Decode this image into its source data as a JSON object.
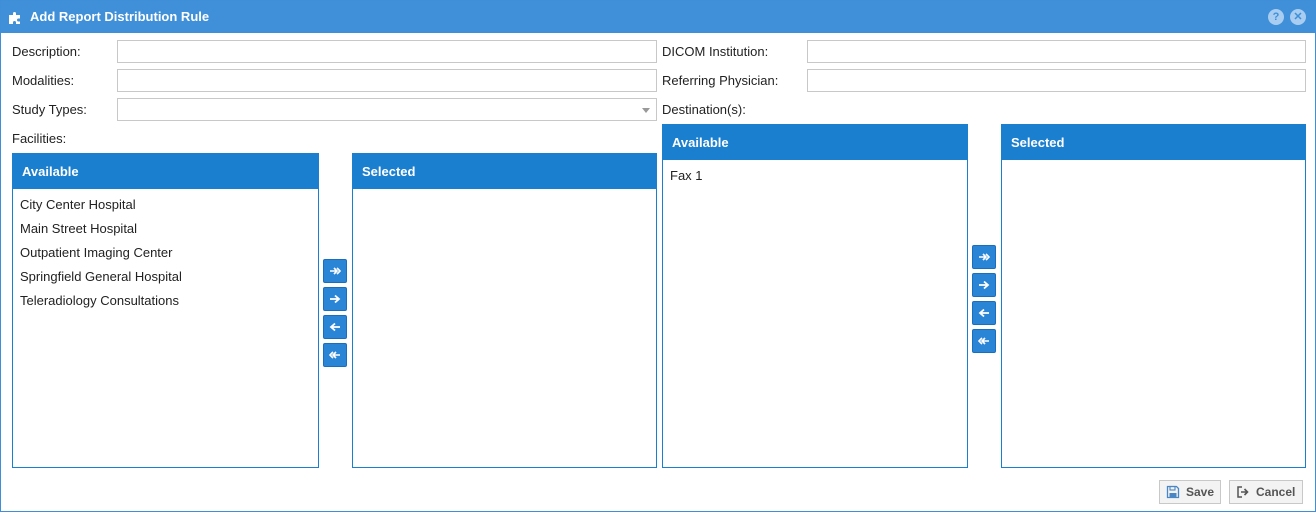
{
  "dialog": {
    "title": "Add Report Distribution Rule",
    "help_icon": "question-icon",
    "close_icon": "close-icon"
  },
  "form": {
    "description_label": "Description:",
    "description_value": "",
    "modalities_label": "Modalities:",
    "modalities_value": "",
    "study_types_label": "Study Types:",
    "study_types_value": "",
    "dicom_institution_label": "DICOM Institution:",
    "dicom_institution_value": "",
    "referring_physician_label": "Referring Physician:",
    "referring_physician_value": "",
    "destinations_label": "Destination(s):",
    "facilities_label": "Facilities:"
  },
  "facilities": {
    "available_header": "Available",
    "selected_header": "Selected",
    "available_items": [
      "City Center Hospital",
      "Main Street Hospital",
      "Outpatient Imaging Center",
      "Springfield General Hospital",
      "Teleradiology Consultations"
    ],
    "selected_items": []
  },
  "destinations": {
    "available_header": "Available",
    "selected_header": "Selected",
    "available_items": [
      "Fax 1"
    ],
    "selected_items": []
  },
  "footer": {
    "save_label": "Save",
    "cancel_label": "Cancel"
  },
  "colors": {
    "titlebar": "#3f8fd9",
    "list_header": "#1b7fcf",
    "move_button": "#2a85d6"
  }
}
